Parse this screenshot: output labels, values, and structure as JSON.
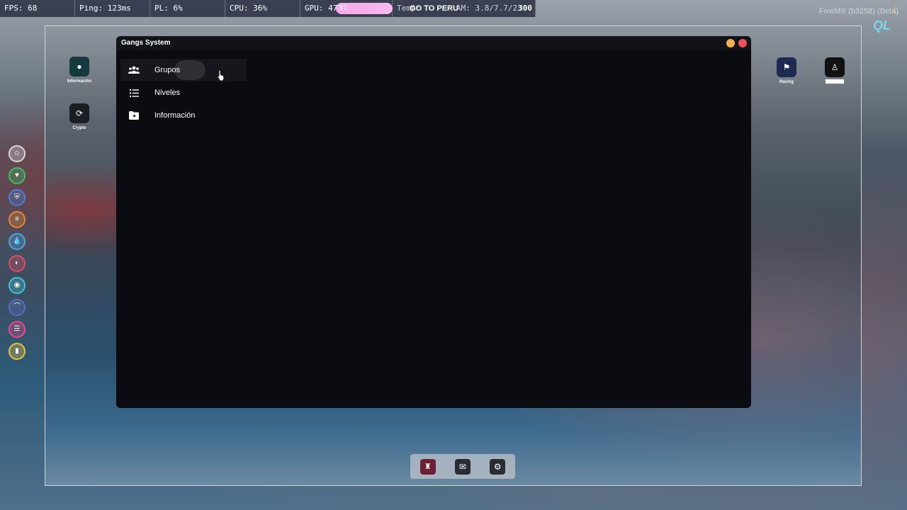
{
  "perf": {
    "fps": "FPS: 68",
    "ping": "Ping: 123ms",
    "pl": "PL: 6%",
    "cpu": "CPU: 36%",
    "gpu": "GPU: 47%",
    "gpu_extra": "87",
    "temp_prefix": "Temp:",
    "banner": "GO TO PERU",
    "ram": "AM: 3.8/7.7/23.",
    "ram_tail": "300"
  },
  "overlay": {
    "fivem": "FiveM® (b3258) (Beta)"
  },
  "apps": {
    "info_label": "Información",
    "crypto_label": "Crypto",
    "racing_label": "Racing"
  },
  "window": {
    "title": "Gangs System",
    "menu": [
      {
        "label": "Grupos",
        "icon": "group-icon",
        "active": true
      },
      {
        "label": "Niveles",
        "icon": "list-icon",
        "active": false
      },
      {
        "label": "Información",
        "icon": "folder-star-icon",
        "active": false
      }
    ]
  },
  "status_colors": [
    "#d9d9d9",
    "#3fbf63",
    "#4a7fd8",
    "#e7872e",
    "#4aa7d8",
    "#e04a67",
    "#41c2d8",
    "#5a6cc0",
    "#e84a87",
    "#e6c53a"
  ],
  "dock": [
    "gang-icon",
    "mail-icon",
    "settings-icon"
  ]
}
